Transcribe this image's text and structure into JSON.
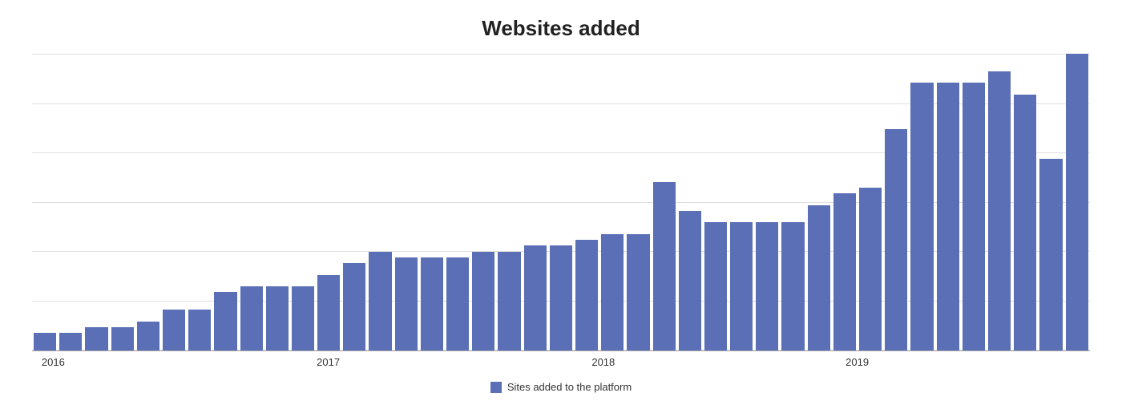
{
  "title": "Websites added",
  "legend_label": "Sites added to the platform",
  "x_labels": [
    {
      "label": "2016",
      "position_pct": 2
    },
    {
      "label": "2017",
      "position_pct": 28
    },
    {
      "label": "2018",
      "position_pct": 54
    },
    {
      "label": "2019",
      "position_pct": 78
    }
  ],
  "bars": [
    {
      "value": 3
    },
    {
      "value": 3
    },
    {
      "value": 4
    },
    {
      "value": 4
    },
    {
      "value": 5
    },
    {
      "value": 7
    },
    {
      "value": 7
    },
    {
      "value": 10
    },
    {
      "value": 11
    },
    {
      "value": 11
    },
    {
      "value": 11
    },
    {
      "value": 13
    },
    {
      "value": 15
    },
    {
      "value": 17
    },
    {
      "value": 16
    },
    {
      "value": 16
    },
    {
      "value": 16
    },
    {
      "value": 17
    },
    {
      "value": 17
    },
    {
      "value": 18
    },
    {
      "value": 18
    },
    {
      "value": 19
    },
    {
      "value": 20
    },
    {
      "value": 20
    },
    {
      "value": 29
    },
    {
      "value": 24
    },
    {
      "value": 22
    },
    {
      "value": 22
    },
    {
      "value": 22
    },
    {
      "value": 22
    },
    {
      "value": 25
    },
    {
      "value": 27
    },
    {
      "value": 28
    },
    {
      "value": 38
    },
    {
      "value": 46
    },
    {
      "value": 46
    },
    {
      "value": 46
    },
    {
      "value": 48
    },
    {
      "value": 44
    },
    {
      "value": 33
    },
    {
      "value": 51
    }
  ],
  "grid_lines": 7,
  "accent_color": "#5a6fb5"
}
